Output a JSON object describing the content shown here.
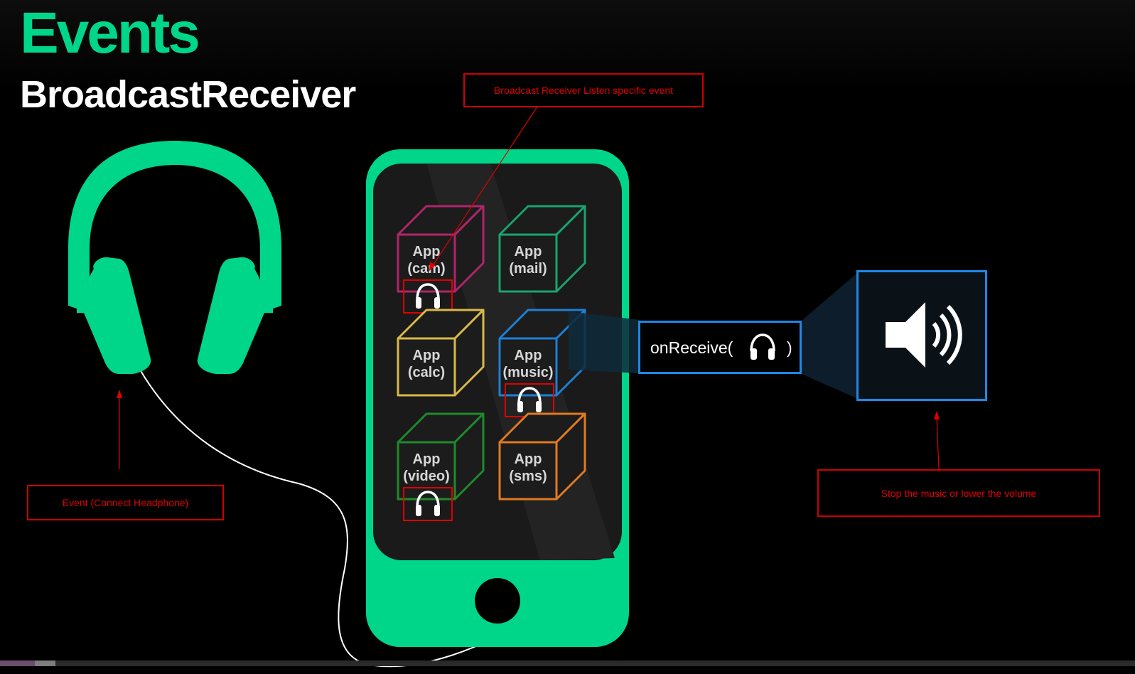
{
  "title": "Events",
  "subtitle": "BroadcastReceiver",
  "annotations": {
    "listen": "Broadcast Receiver Listen specific event",
    "event": "Event (Connect Headphone)",
    "stop": "Stop the music or lower the volume"
  },
  "apps": [
    {
      "line1": "App",
      "line2": "(cam)",
      "color": "#b0256a",
      "listens": true
    },
    {
      "line1": "App",
      "line2": "(mail)",
      "color": "#1aa36e",
      "listens": false
    },
    {
      "line1": "App",
      "line2": "(calc)",
      "color": "#d9b84a",
      "listens": false
    },
    {
      "line1": "App",
      "line2": "(music)",
      "color": "#1e7fd6",
      "listens": true
    },
    {
      "line1": "App",
      "line2": "(video)",
      "color": "#1f8a2a",
      "listens": true
    },
    {
      "line1": "App",
      "line2": "(sms)",
      "color": "#e07a22",
      "listens": false
    }
  ],
  "on_receive": {
    "prefix": "onReceive(",
    "suffix": ")"
  },
  "colors": {
    "accent": "#00d68a",
    "annotation": "#e00000",
    "highlight": "#1e88e5"
  },
  "icons": [
    "headphones-icon",
    "speaker-volume-icon"
  ]
}
